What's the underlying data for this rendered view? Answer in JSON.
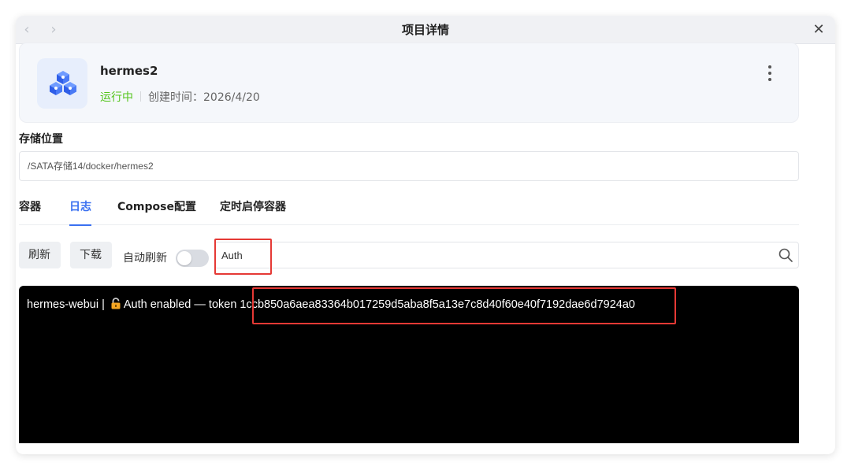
{
  "window": {
    "title": "项目详情",
    "back_glyph": "‹",
    "forward_glyph": "›",
    "close_glyph": "✕"
  },
  "project": {
    "name": "hermes2",
    "status": "运行中",
    "created_label": "创建时间：",
    "created_date": "2026/4/20",
    "icon": "cubes-icon"
  },
  "storage": {
    "label": "存储位置",
    "path": "/SATA存储14/docker/hermes2"
  },
  "tabs": [
    {
      "label": "容器"
    },
    {
      "label": "日志",
      "active": true
    },
    {
      "label": "Compose配置"
    },
    {
      "label": "定时启停容器"
    }
  ],
  "toolbar": {
    "refresh_label": "刷新",
    "download_label": "下载",
    "auto_refresh_label": "自动刷新",
    "auto_refresh_on": false,
    "search_value": "Auth"
  },
  "log": {
    "prefix": "hermes-webui | ",
    "message": "Auth enabled — token",
    "token": "1ccb850a6aea83364b017259d5aba8f5a13e7c8d40f60e40f7192dae6d7924a0"
  },
  "colors": {
    "accent": "#3a70f0",
    "running": "#52c41a",
    "highlight": "#e53935"
  }
}
